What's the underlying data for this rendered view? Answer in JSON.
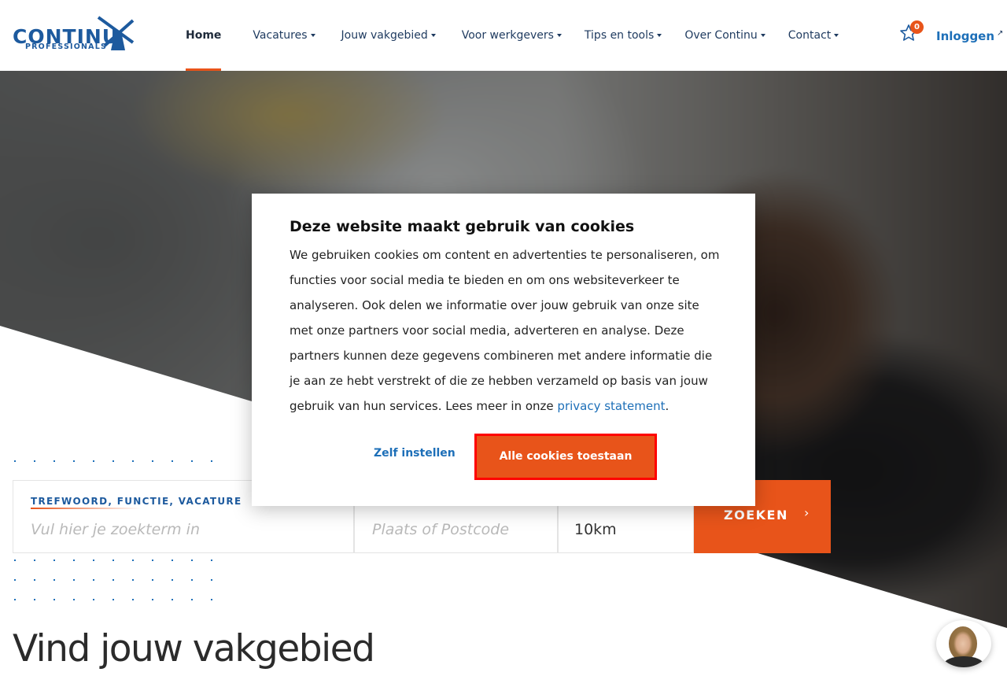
{
  "logo": {
    "brand": "CONTINU",
    "sub": "PROFESSIONALS"
  },
  "nav": [
    {
      "label": "Home",
      "active": true,
      "dropdown": false
    },
    {
      "label": "Vacatures",
      "active": false,
      "dropdown": true
    },
    {
      "label": "Jouw vakgebied",
      "active": false,
      "dropdown": true
    },
    {
      "label": "Voor werkgevers",
      "active": false,
      "dropdown": true
    },
    {
      "label": "Tips en tools",
      "active": false,
      "dropdown": true
    },
    {
      "label": "Over Continu",
      "active": false,
      "dropdown": true
    },
    {
      "label": "Contact",
      "active": false,
      "dropdown": true
    }
  ],
  "favorites": {
    "count": "0",
    "icon": "star-icon"
  },
  "login": {
    "label": "Inloggen",
    "icon": "external-link-icon",
    "arrow": "↗"
  },
  "cookie": {
    "title": "Deze website maakt gebruik van cookies",
    "body": "We gebruiken cookies om content en advertenties te personaliseren, om functies voor social media te bieden en om ons websiteverkeer te analyseren. Ook delen we informatie over jouw gebruik van onze site met onze partners voor social media, adverteren en analyse. Deze partners kunnen deze gegevens combineren met andere informatie die je aan ze hebt verstrekt of die ze hebben verzameld op basis van jouw gebruik van hun services. Lees meer in onze ",
    "link": "privacy statement",
    "period": ".",
    "custom_label": "Zelf instellen",
    "accept_label": "Alle cookies toestaan"
  },
  "search": {
    "keyword_label": "TREFWOORD, FUNCTIE, VACATURE",
    "keyword_placeholder": "Vul hier je zoekterm in",
    "location_placeholder": "Plaats of Postcode",
    "radius_value": "10km",
    "submit_label": "ZOEKEN",
    "submit_icon": "chevron-right-icon"
  },
  "section": {
    "title": "Vind jouw vakgebied"
  },
  "colors": {
    "accent": "#e8541a",
    "brand": "#1d5a9e",
    "link": "#1d6fb8",
    "highlight": "#ff0000"
  }
}
